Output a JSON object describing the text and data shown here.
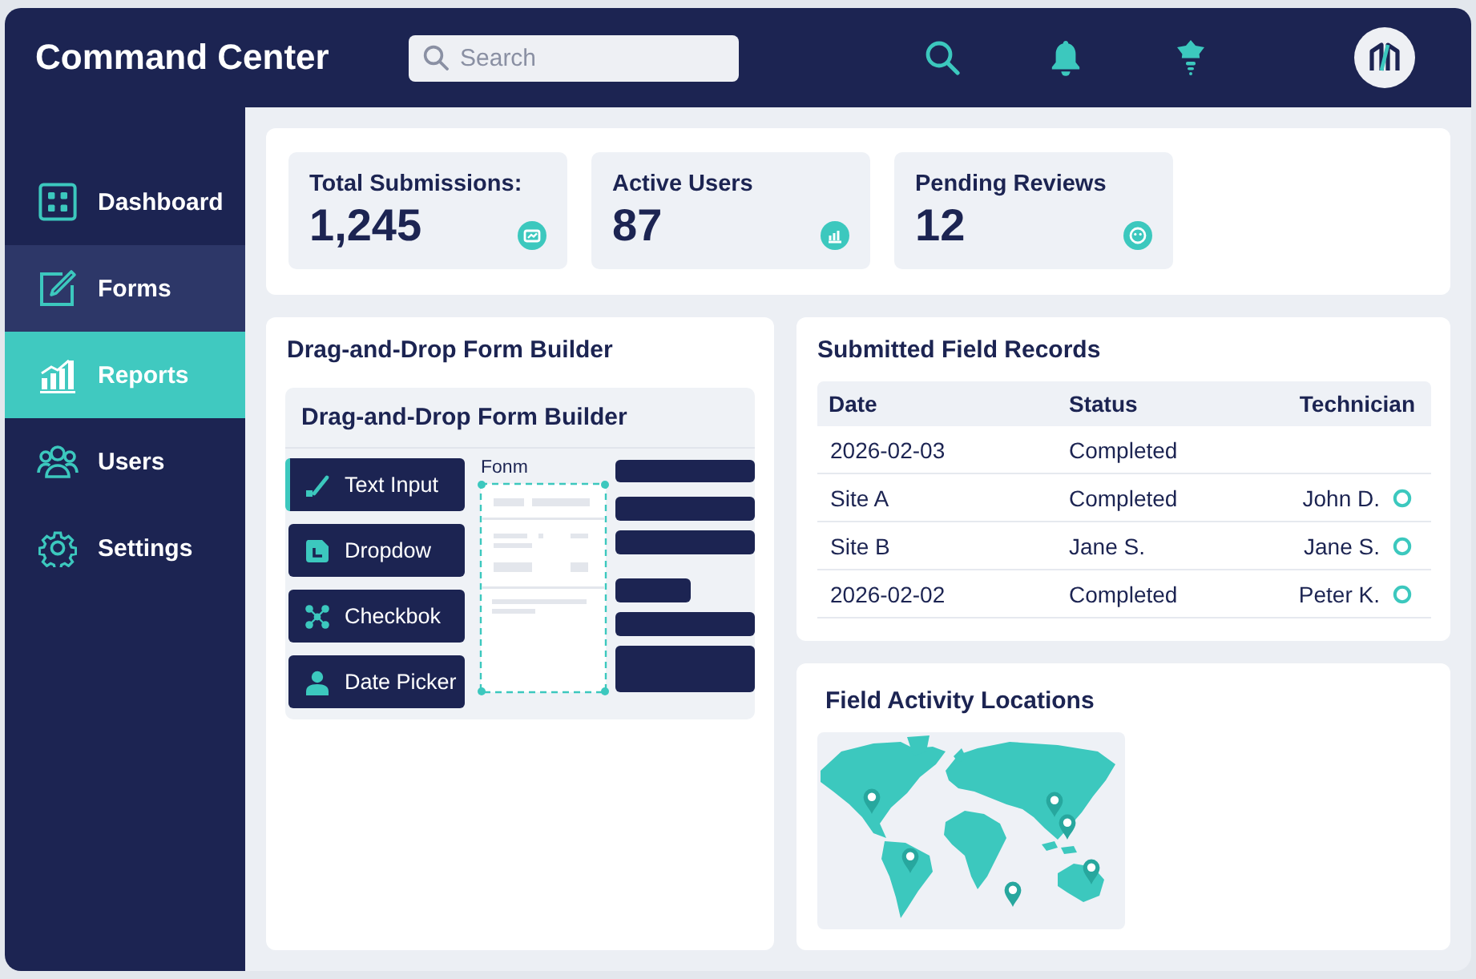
{
  "header": {
    "title": "Command Center",
    "search": {
      "placeholder": "Search"
    }
  },
  "sidebar": {
    "items": [
      {
        "label": "Dashboard",
        "selected": false,
        "hovered": false
      },
      {
        "label": "Forms",
        "selected": false,
        "hovered": true
      },
      {
        "label": "Reports",
        "selected": true,
        "hovered": false
      },
      {
        "label": "Users",
        "selected": false,
        "hovered": false
      },
      {
        "label": "Settings",
        "selected": false,
        "hovered": false
      }
    ]
  },
  "stats": [
    {
      "label": "Total Submissions:",
      "value": "1,245"
    },
    {
      "label": "Active Users",
      "value": "87"
    },
    {
      "label": "Pending Reviews",
      "value": "12"
    }
  ],
  "form_builder": {
    "title": "Drag-and-Drop Form Builder",
    "inner_title": "Drag-and-Drop Form Builder",
    "palette": [
      {
        "label": "Text Input",
        "selected": true
      },
      {
        "label": "Dropdow",
        "selected": false
      },
      {
        "label": "Checkbok",
        "selected": false
      },
      {
        "label": "Date Picker",
        "selected": false
      }
    ],
    "canvas_label": "Fonm"
  },
  "records": {
    "title": "Submitted Field Records",
    "columns": [
      "Date",
      "Status",
      "Technician"
    ],
    "rows": [
      {
        "date": "2026-02-03",
        "status": "Completed"
      },
      {
        "date": "Site A",
        "status": "Completed",
        "technician": "John D."
      },
      {
        "date": "Site B",
        "status": "Jane S.",
        "technician": "Jane S."
      },
      {
        "date": "2026-02-02",
        "status": "Completed",
        "technician": "Peter K."
      }
    ]
  },
  "locations": {
    "title": "Field Activity Locations"
  }
}
